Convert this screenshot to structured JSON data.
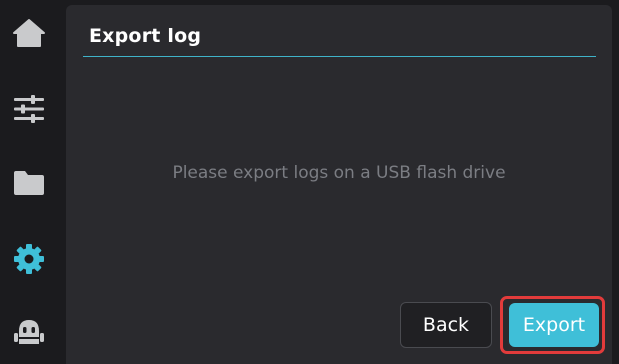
{
  "sidebar": {
    "items": [
      {
        "name": "home",
        "icon": "home-icon",
        "active": false
      },
      {
        "name": "controls",
        "icon": "sliders-icon",
        "active": false
      },
      {
        "name": "files",
        "icon": "folder-icon",
        "active": false
      },
      {
        "name": "settings",
        "icon": "gear-icon",
        "active": true
      },
      {
        "name": "robot",
        "icon": "robot-icon",
        "active": false
      }
    ]
  },
  "panel": {
    "title": "Export log",
    "message": "Please export logs on a USB flash drive"
  },
  "buttons": {
    "back_label": "Back",
    "export_label": "Export"
  },
  "colors": {
    "accent": "#3fbfd8",
    "icon": "#c9cacc",
    "highlight": "#e23b3b"
  }
}
